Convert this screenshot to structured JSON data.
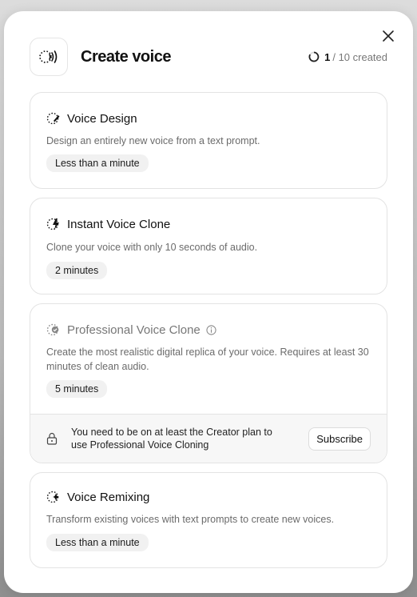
{
  "header": {
    "title": "Create voice",
    "counter_used": "1",
    "counter_rest": "/ 10 created"
  },
  "cards": [
    {
      "icon": "sparkle-pen-icon",
      "title": "Voice Design",
      "description": "Design an entirely new voice from a text prompt.",
      "duration": "Less than a minute"
    },
    {
      "icon": "lightning-icon",
      "title": "Instant Voice Clone",
      "description": "Clone your voice with only 10 seconds of audio.",
      "duration": "2 minutes"
    },
    {
      "icon": "verified-badge-icon",
      "title": "Professional Voice Clone",
      "description": "Create the most realistic digital replica of your voice. Requires at least 30 minutes of clean audio.",
      "duration": "5 minutes",
      "upsell_text": "You need to be on at least the Creator plan to use Professional Voice Cloning",
      "upsell_button": "Subscribe"
    },
    {
      "icon": "sparkle-icon",
      "title": "Voice Remixing",
      "description": "Transform existing voices with text prompts to create new voices.",
      "duration": "Less than a minute"
    }
  ]
}
